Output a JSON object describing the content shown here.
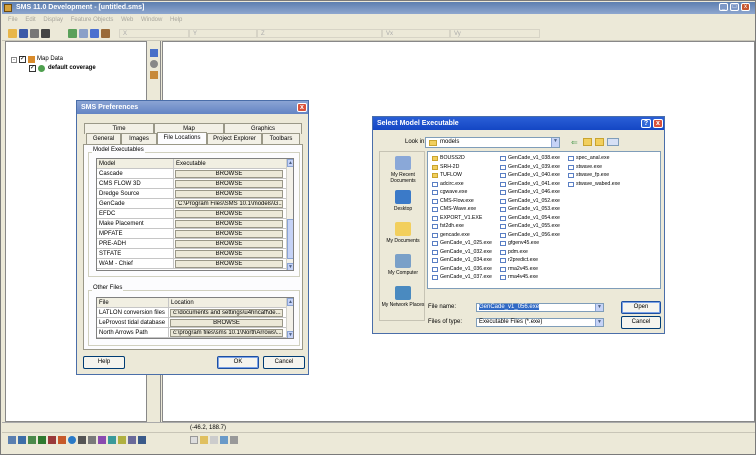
{
  "app": {
    "title": "SMS 11.0 Development - [untitled.sms]",
    "menu": [
      "File",
      "Edit",
      "Display",
      "Feature Objects",
      "Web",
      "Window",
      "Help"
    ],
    "toolbar_fields": [
      "X",
      "Y",
      "Z",
      "Vx",
      "Vy"
    ]
  },
  "tree": {
    "root": "Map Data",
    "child": "default coverage"
  },
  "status": {
    "coords": "(-46.2, 188.7)"
  },
  "prefs": {
    "title": "SMS Preferences",
    "tabs_top": [
      "Time",
      "Map",
      "Graphics"
    ],
    "tabs_bottom": [
      "General",
      "Images",
      "File Locations",
      "Project Explorer",
      "Toolbars"
    ],
    "selected_tab": "File Locations",
    "model_group": "Model Executables",
    "model_headers": [
      "Model",
      "Executable"
    ],
    "models": [
      {
        "name": "Cascade",
        "value": "BROWSE"
      },
      {
        "name": "CMS FLOW 3D",
        "value": "BROWSE"
      },
      {
        "name": "Dredge Source",
        "value": "BROWSE"
      },
      {
        "name": "GenCade",
        "value": "C:\\Program Files\\SMS 10.1\\models\\G..."
      },
      {
        "name": "EFDC",
        "value": "BROWSE"
      },
      {
        "name": "Make Placement",
        "value": "BROWSE"
      },
      {
        "name": "MPFATE",
        "value": "BROWSE"
      },
      {
        "name": "PRE-ADH",
        "value": "BROWSE"
      },
      {
        "name": "STFATE",
        "value": "BROWSE"
      },
      {
        "name": "WAM - Chief",
        "value": "BROWSE"
      }
    ],
    "other_group": "Other Files",
    "other_headers": [
      "File",
      "Location"
    ],
    "others": [
      {
        "name": "LATLON conversion files",
        "value": "c:\\documents and settings\\u4hncaff\\de..."
      },
      {
        "name": "LeProvost tidal database",
        "value": "BROWSE"
      },
      {
        "name": "North Arrows Path",
        "value": "c:\\program files\\sms 10.1\\NorthArrows\\..."
      }
    ],
    "help": "Help",
    "ok": "OK",
    "cancel": "Cancel"
  },
  "select": {
    "title": "Select Model Executable",
    "look_in_label": "Look in:",
    "look_in_value": "models",
    "places": [
      "My Recent Documents",
      "Desktop",
      "My Documents",
      "My Computer",
      "My Network Places"
    ],
    "files": [
      [
        "BOUSS2D",
        "SRH-2D",
        "TUFLOW",
        "adcirc.exe",
        "cgwave.exe",
        "CMS-Flow.exe",
        "CMS-Wave.exe",
        "EXPORT_V1.EXE",
        "fst2dh.exe",
        "gencade.exe",
        "GenCade_v1_025.exe",
        "GenCade_v1_032.exe",
        "GenCade_v1_034.exe",
        "GenCade_v1_036.exe",
        "GenCade_v1_037.exe"
      ],
      [
        "GenCade_v1_038.exe",
        "GenCade_v1_039.exe",
        "GenCade_v1_040.exe",
        "GenCade_v1_041.exe",
        "GenCade_v1_046.exe",
        "GenCade_v1_052.exe",
        "GenCade_v1_053.exe",
        "GenCade_v1_054.exe",
        "GenCade_v1_055.exe",
        "GenCade_v1_056.exe",
        "gfgenv45.exe",
        "pdm.exe",
        "r2predict.exe",
        "rma2v45.exe",
        "rma4v45.exe"
      ],
      [
        "spec_anal.exe",
        "stwave.exe",
        "stwave_fp.exe",
        "stwave_wabed.exe"
      ]
    ],
    "file_name_label": "File name:",
    "file_name_value": "GenCade_v1_056.exe",
    "file_type_label": "Files of type:",
    "file_type_value": "Executable Files (*.exe)",
    "open": "Open",
    "cancel": "Cancel"
  }
}
